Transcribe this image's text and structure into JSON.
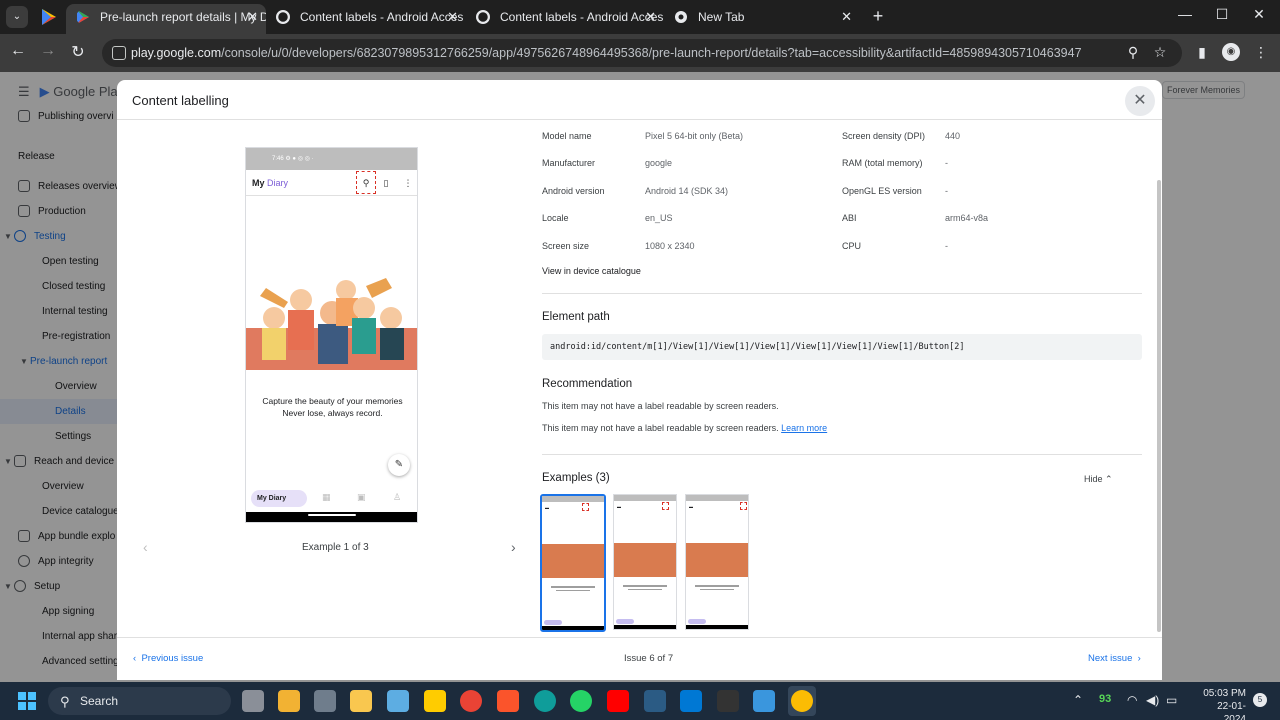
{
  "browser": {
    "tabs": [
      {
        "title": "Pre-launch report details | My D",
        "active": true
      },
      {
        "title": "Content labels - Android Acces",
        "active": false
      },
      {
        "title": "Content labels - Android Acces",
        "active": false
      },
      {
        "title": "New Tab",
        "active": false
      }
    ],
    "url_host": "play.google.com",
    "url_path": "/console/u/0/developers/6823079895312766259/app/4975626748964495368/pre-launch-report/details?tab=accessibility&artifactId=4859894305710463947"
  },
  "sidebar": {
    "logo": "Google Play",
    "items": [
      {
        "label": "Publishing overvi",
        "icon": "publish-icon"
      },
      {
        "label": "Release",
        "icon": ""
      },
      {
        "label": "Releases overview",
        "icon": "grid-icon"
      },
      {
        "label": "Production",
        "icon": "warning-icon"
      },
      {
        "label": "Testing",
        "icon": "refresh-icon"
      },
      {
        "label": "Open testing",
        "icon": ""
      },
      {
        "label": "Closed testing",
        "icon": ""
      },
      {
        "label": "Internal testing",
        "icon": ""
      },
      {
        "label": "Pre-registration",
        "icon": ""
      },
      {
        "label": "Pre-launch report",
        "icon": ""
      },
      {
        "label": "Overview",
        "icon": ""
      },
      {
        "label": "Details",
        "icon": ""
      },
      {
        "label": "Settings",
        "icon": ""
      },
      {
        "label": "Reach and device",
        "icon": "chart-icon"
      },
      {
        "label": "Overview",
        "icon": ""
      },
      {
        "label": "Device catalogue",
        "icon": ""
      },
      {
        "label": "App bundle explo",
        "icon": "bundle-icon"
      },
      {
        "label": "App integrity",
        "icon": "shield-icon"
      },
      {
        "label": "Setup",
        "icon": "gear-icon"
      },
      {
        "label": "App signing",
        "icon": ""
      },
      {
        "label": "Internal app shari",
        "icon": ""
      },
      {
        "label": "Advanced setting",
        "icon": ""
      }
    ]
  },
  "bg_chip": "Forever Memories",
  "dialog": {
    "title": "Content labelling",
    "phone": {
      "status_time": "7:46",
      "app_title_a": "My ",
      "app_title_b": "Diary",
      "caption_line1": "Capture the beauty of your memories",
      "caption_line2": "Never lose, always record.",
      "nav_chip": "My Diary"
    },
    "example_counter": "Example 1 of 3",
    "details_left": [
      {
        "label": "Model name",
        "value": "Pixel 5 64-bit only (Beta)"
      },
      {
        "label": "Manufacturer",
        "value": "google"
      },
      {
        "label": "Android version",
        "value": "Android 14 (SDK 34)"
      },
      {
        "label": "Locale",
        "value": "en_US"
      },
      {
        "label": "Screen size",
        "value": "1080 x 2340"
      }
    ],
    "details_right": [
      {
        "label": "Screen density (DPI)",
        "value": "440"
      },
      {
        "label": "RAM (total memory)",
        "value": "-"
      },
      {
        "label": "OpenGL ES version",
        "value": "-"
      },
      {
        "label": "ABI",
        "value": "arm64-v8a"
      },
      {
        "label": "CPU",
        "value": "-"
      }
    ],
    "device_catalogue_link": "View in device catalogue",
    "element_path_heading": "Element path",
    "element_path": "android:id/content/m[1]/View[1]/View[1]/View[1]/View[1]/View[1]/View[1]/Button[2]",
    "recommendation_heading": "Recommendation",
    "recommendation_1": "This item may not have a label readable by screen readers.",
    "recommendation_2": "This item may not have a label readable by screen readers.",
    "learn_more": "Learn more",
    "examples_heading": "Examples (3)",
    "hide_label": "Hide",
    "prev_issue": "Previous issue",
    "issue_counter": "Issue 6 of 7",
    "next_issue": "Next issue"
  },
  "taskbar": {
    "search_placeholder": "Search",
    "battery": "93",
    "time": "05:03 PM",
    "date": "22-01-2024",
    "notifications": "5"
  }
}
